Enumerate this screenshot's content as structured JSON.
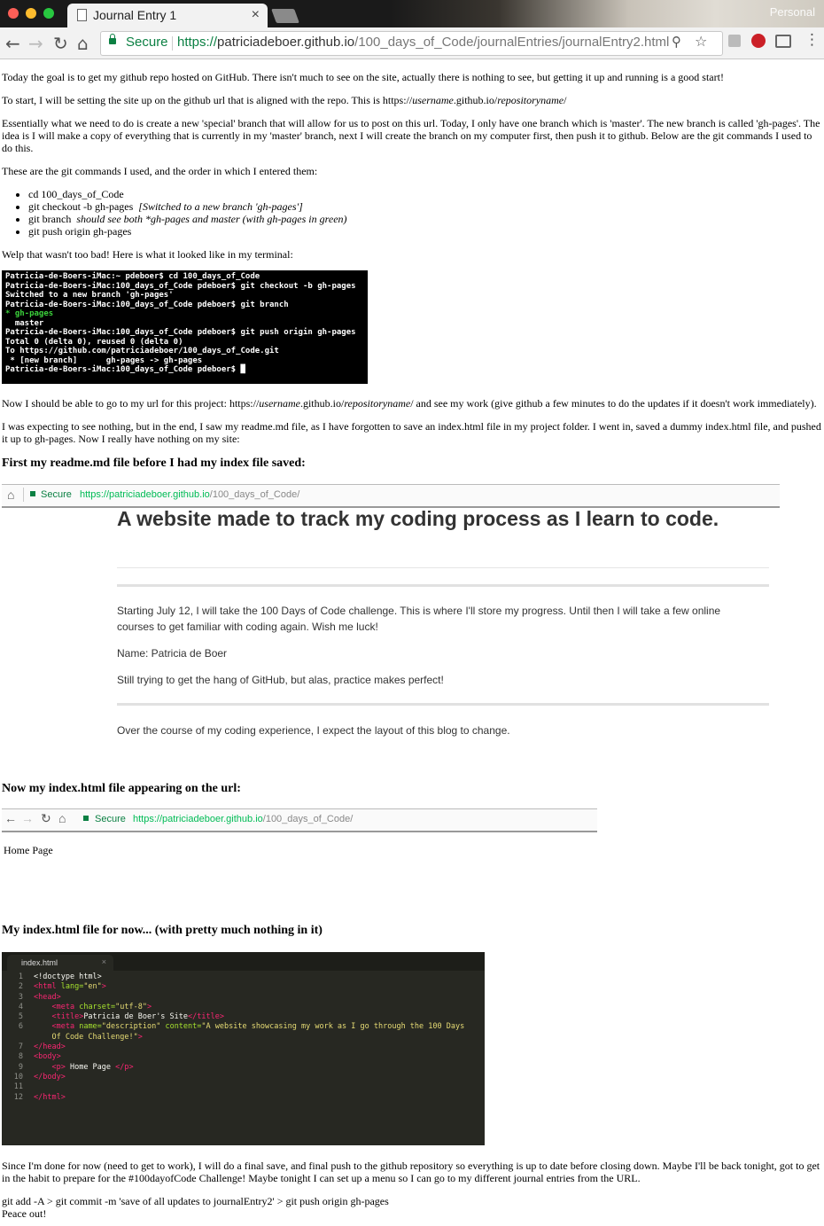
{
  "browser": {
    "tab_title": "Journal Entry 1",
    "tab_close": "×",
    "profile": "Personal",
    "secure_label": "Secure",
    "url_scheme": "https://",
    "url_host": "patriciadeboer.github.io",
    "url_path": "/100_days_of_Code/journalEntries/journalEntry2.html",
    "icons": [
      "back-icon",
      "forward-icon",
      "reload-icon",
      "home-icon",
      "lock-icon",
      "zoom-icon",
      "star-icon",
      "extension-icon",
      "pinterest-icon",
      "cast-icon",
      "menu-icon"
    ]
  },
  "article": {
    "p1": "Today the goal is to get my github repo hosted on GitHub. There isn't much to see on the site, actually there is nothing to see, but getting it up and running is a good start!",
    "p2_pre": "To start, I will be setting the site up on the github url that is aligned with the repo. This is https://",
    "p2_user": "username",
    "p2_mid": ".github.io/",
    "p2_repo": "repositoryname",
    "p2_end": "/",
    "p3": "Essentially what we need to do is create a new 'special' branch that will allow for us to post on this url. Today, I only have one branch which is 'master'. The new branch is called 'gh-pages'. The idea is I will make a copy of everything that is currently in my 'master' branch, next I will create the branch on my computer first, then push it to github. Below are the git commands I used to do this.",
    "p4": "These are the git commands I used, and the order in which I entered them:",
    "commands": [
      {
        "cmd": "cd 100_days_of_Code",
        "note": ""
      },
      {
        "cmd": "git checkout -b gh-pages",
        "note": "[Switched to a new branch 'gh-pages']"
      },
      {
        "cmd": "git branch",
        "note": "should see both *gh-pages and master (with gh-pages in green)"
      },
      {
        "cmd": "git push origin gh-pages",
        "note": ""
      }
    ],
    "p5": "Welp that wasn't too bad! Here is what it looked like in my terminal:",
    "terminal_lines": [
      "Patricia-de-Boers-iMac:~ pdeboer$ cd 100_days_of_Code",
      "Patricia-de-Boers-iMac:100_days_of_Code pdeboer$ git checkout -b gh-pages",
      "Switched to a new branch 'gh-pages'",
      "Patricia-de-Boers-iMac:100_days_of_Code pdeboer$ git branch",
      "* gh-pages",
      "  master",
      "Patricia-de-Boers-iMac:100_days_of_Code pdeboer$ git push origin gh-pages",
      "Total 0 (delta 0), reused 0 (delta 0)",
      "To https://github.com/patriciadeboer/100_days_of_Code.git",
      " * [new branch]      gh-pages -> gh-pages",
      "Patricia-de-Boers-iMac:100_days_of_Code pdeboer$ █"
    ],
    "p6_pre": "Now I should be able to go to my url for this project: https://",
    "p6_user": "username",
    "p6_mid": ".github.io/",
    "p6_repo": "repositoryname",
    "p6_end": "/ and see my work (give github a few minutes to do the updates if it doesn't work immediately).",
    "p7": "I was expecting to see nothing, but in the end, I saw my readme.md file, as I have forgotten to save an index.html file in my project folder. I went in, saved a dummy index.html file, and pushed it up to gh-pages. Now I really have nothing on my site:",
    "h_readme": "First my readme.md file before I had my index file saved:",
    "shot1": {
      "secure": "Secure",
      "url_host": "https://patriciadeboer.github.io",
      "url_path": "/100_days_of_Code/",
      "heading": "A website made to track my coding process as I learn to code.",
      "para1": "Starting July 12, I will take the 100 Days of Code challenge. This is where I'll store my progress. Until then I will take a few online courses to get familiar with coding again. Wish me luck!",
      "para2": "Name: Patricia de Boer",
      "para3": "Still trying to get the hang of GitHub, but alas, practice makes perfect!",
      "para4": "Over the course of my coding experience, I expect the layout of this blog to change."
    },
    "h_index": "Now my index.html file appearing on the url:",
    "shot2": {
      "secure": "Secure",
      "url_host": "https://patriciadeboer.github.io",
      "url_path": "/100_days_of_Code/",
      "body": "Home Page"
    },
    "h_code": "My index.html file for now... (with pretty much nothing in it)",
    "editor": {
      "tab": "index.html",
      "tab_close": "×"
    },
    "p_final": "Since I'm done for now (need to get to work), I will do a final save, and final push to the github repository so everything is up to date before closing down. Maybe I'll be back tonight, got to get in the habit to prepare for the #100dayofCode Challenge! Maybe tonight I can set up a menu so I can go to my different journal entries from the URL.",
    "git_line": "git add -A > git commit -m 'save of all updates to journalEntry2' > git push origin gh-pages",
    "signoff": "Peace out!"
  }
}
